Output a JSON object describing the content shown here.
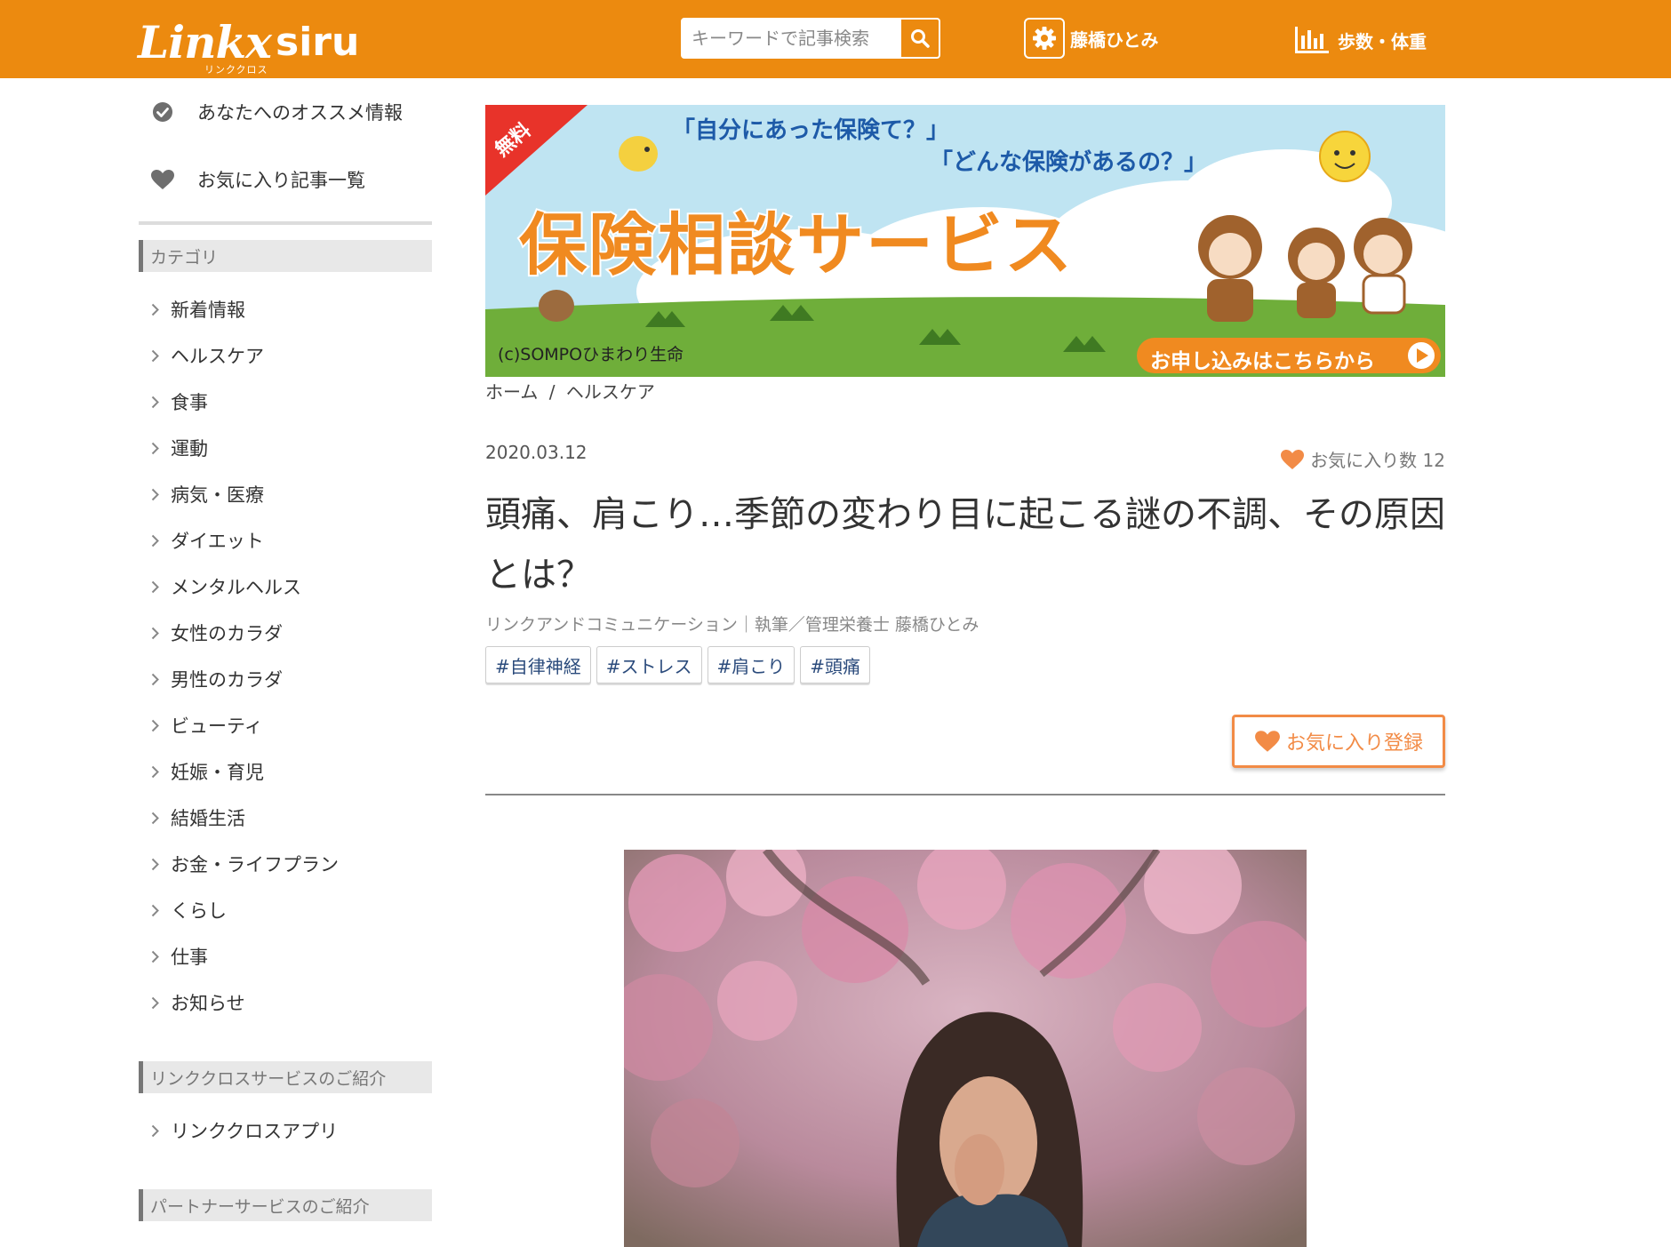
{
  "header": {
    "logo_text": "Linkx",
    "logo_siru": "siru",
    "logo_sub": "リンククロス",
    "search_placeholder": "キーワードで記事検索",
    "user_name": "藤橋ひとみ",
    "steps_label": "歩数・体重"
  },
  "sidebar": {
    "top_items": [
      {
        "label": "あなたへのオススメ情報",
        "icon": "check-circle-icon"
      },
      {
        "label": "お気に入り記事一覧",
        "icon": "heart-icon"
      }
    ],
    "category_heading": "カテゴリ",
    "categories": [
      "新着情報",
      "ヘルスケア",
      "食事",
      "運動",
      "病気・医療",
      "ダイエット",
      "メンタルヘルス",
      "女性のカラダ",
      "男性のカラダ",
      "ビューティ",
      "妊娠・育児",
      "結婚生活",
      "お金・ライフプラン",
      "くらし",
      "仕事",
      "お知らせ"
    ],
    "service_heading": "リンククロスサービスのご紹介",
    "services": [
      "リンククロスアプリ"
    ],
    "partner_heading": "パートナーサービスのご紹介"
  },
  "banner": {
    "badge": "無料",
    "line1": "「自分にあった保険て？」",
    "line2": "「どんな保険があるの？」",
    "headline": "保険相談サービス",
    "credit": "(c)SOMPOひまわり生命",
    "cta": "お申し込みはこちらから"
  },
  "article": {
    "breadcrumb_home": "ホーム",
    "breadcrumb_sep": "/",
    "breadcrumb_cat": "ヘルスケア",
    "date": "2020.03.12",
    "fav_count_label": "お気に入り数 12",
    "title": "頭痛、肩こり…季節の変わり目に起こる謎の不調、その原因とは？",
    "author": "リンクアンドコミュニケーション｜執筆／管理栄養士 藤橋ひとみ",
    "tags": [
      "#自律神経",
      "#ストレス",
      "#肩こり",
      "#頭痛"
    ],
    "fav_button": "お気に入り登録"
  },
  "colors": {
    "brand_orange": "#ec8a0f",
    "heart": "#f28b46",
    "tag_text": "#2b4b7c"
  }
}
